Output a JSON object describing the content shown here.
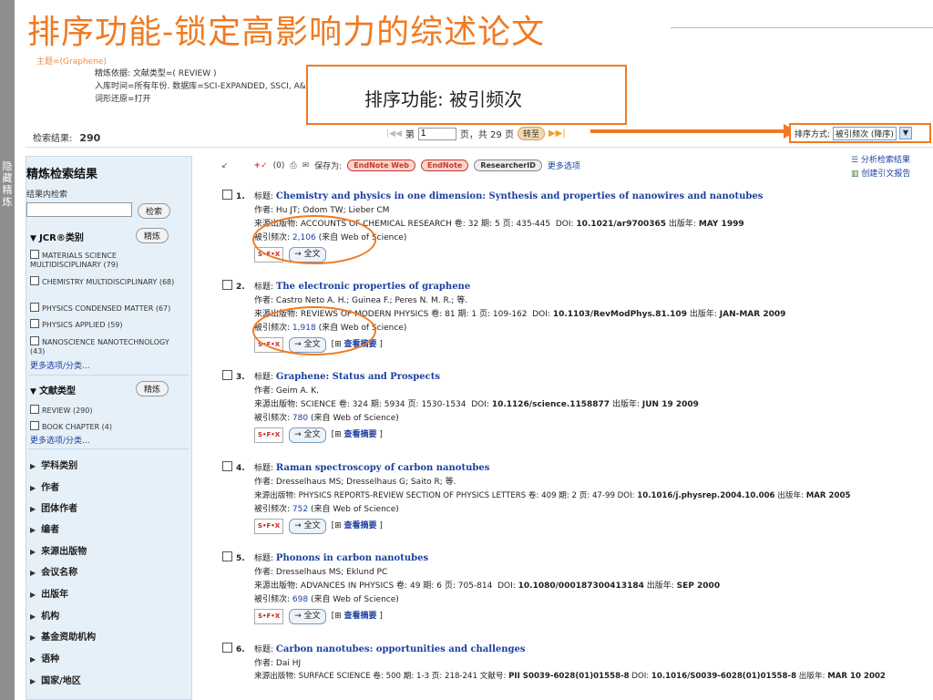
{
  "slide_title": "排序功能-锁定高影响力的综述论文",
  "callout_text": "排序功能: 被引频次",
  "left_tab": "隐藏精炼",
  "search_meta": {
    "hidden_line": "主题=(Graphene)",
    "lines": [
      "精炼依据: 文献类型=( REVIEW )",
      "入库时间=所有年份. 数据库=SCI-EXPANDED, SSCI, A&",
      "词形还原=打开"
    ]
  },
  "results": {
    "label": "检索结果:",
    "count": "290"
  },
  "pager": {
    "page_prefix": "第",
    "page_value": "1",
    "page_suffix": "页，共 29 页",
    "go": "转至"
  },
  "sort": {
    "label": "排序方式:",
    "value": "被引频次 (降序)"
  },
  "sidebar": {
    "title": "精炼检索结果",
    "within_label": "结果内检索",
    "search_btn": "检索",
    "refine_btn": "精炼",
    "jcr": {
      "title": "JCR®类别",
      "items": [
        "MATERIALS SCIENCE MULTIDISCIPLINARY (79)",
        "CHEMISTRY MULTIDISCIPLINARY (68)",
        "PHYSICS CONDENSED MATTER (67)",
        "PHYSICS APPLIED (59)",
        "NANOSCIENCE NANOTECHNOLOGY (43)"
      ],
      "more": "更多选项/分类..."
    },
    "doctype": {
      "title": "文献类型",
      "items": [
        "REVIEW (290)",
        "BOOK CHAPTER (4)"
      ],
      "more": "更多选项/分类..."
    },
    "facets": [
      "学科类别",
      "作者",
      "团体作者",
      "编者",
      "来源出版物",
      "会议名称",
      "出版年",
      "机构",
      "基金资助机构",
      "语种",
      "国家/地区"
    ]
  },
  "toolbar": {
    "marked": "(0)",
    "save_label": "保存为:",
    "endnote_web": "EndNote Web",
    "endnote": "EndNote",
    "researcherid": "ResearcherID",
    "more": "更多选项"
  },
  "right_links": [
    "分析检索结果",
    "创建引文报告"
  ],
  "labels": {
    "title": "标题:",
    "author": "作者:",
    "source": "来源出版物:",
    "cited": "被引频次:",
    "fulltext": "→ 全文",
    "abstract": "查看摘要",
    "vol": "卷:",
    "issue": "期:",
    "pages": "页:",
    "pubyear": "出版年:",
    "wos": "(来自 Web of Science)",
    "sfx": "S•F•X"
  },
  "records": [
    {
      "num": "1.",
      "title": "Chemistry and physics in one dimension: Synthesis and properties of nanowires and nanotubes",
      "authors": "Hu JT; Odom TW; Lieber CM",
      "source": "ACCOUNTS OF CHEMICAL RESEARCH",
      "vol": "32",
      "issue": "5",
      "pages": "435-445",
      "doi": "10.1021/ar9700365",
      "year": "MAY 1999",
      "cited": "2,106",
      "abstract": false
    },
    {
      "num": "2.",
      "title": "The electronic properties of graphene",
      "authors": "Castro Neto A. H.; Guinea F.; Peres N. M. R.; 等.",
      "source": "REVIEWS OF MODERN PHYSICS",
      "vol": "81",
      "issue": "1",
      "pages": "109-162",
      "doi": "10.1103/RevModPhys.81.109",
      "year": "JAN-MAR 2009",
      "cited": "1,918",
      "abstract": true
    },
    {
      "num": "3.",
      "title": "Graphene: Status and Prospects",
      "authors": "Geim A. K.",
      "source": "SCIENCE",
      "vol": "324",
      "issue": "5934",
      "pages": "1530-1534",
      "doi": "10.1126/science.1158877",
      "year": "JUN 19 2009",
      "cited": "780",
      "abstract": true
    },
    {
      "num": "4.",
      "title": "Raman spectroscopy of carbon nanotubes",
      "authors": "Dresselhaus MS; Dresselhaus G; Saito R; 等.",
      "source": "PHYSICS REPORTS-REVIEW SECTION OF PHYSICS LETTERS",
      "vol": "409",
      "issue": "2",
      "pages": "47-99",
      "doi": "10.1016/j.physrep.2004.10.006",
      "year": "MAR 2005",
      "cited": "752",
      "abstract": true
    },
    {
      "num": "5.",
      "title": "Phonons in carbon nanotubes",
      "authors": "Dresselhaus MS; Eklund PC",
      "source": "ADVANCES IN PHYSICS",
      "vol": "49",
      "issue": "6",
      "pages": "705-814",
      "doi": "10.1080/000187300413184",
      "year": "SEP 2000",
      "cited": "698",
      "abstract": true
    },
    {
      "num": "6.",
      "title": "Carbon nanotubes: opportunities and challenges",
      "authors": "Dai HJ",
      "source": "SURFACE SCIENCE",
      "vol": "500",
      "issue": "1-3",
      "pages": "218-241",
      "article_label": "文献号:",
      "article": "PII S0039-6028(01)01558-8",
      "doi": "10.1016/S0039-6028(01)01558-8",
      "year": "MAR 10 2002"
    }
  ]
}
